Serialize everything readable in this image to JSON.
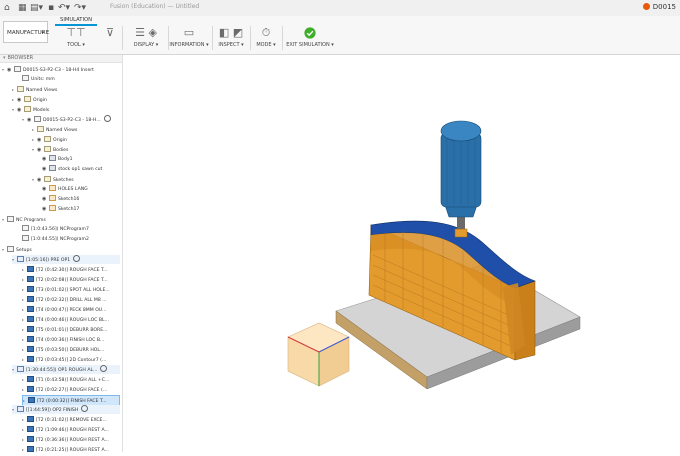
{
  "titlebar": {
    "doc_title": "Fusion (Education) — Untitled",
    "right_label": "D0015"
  },
  "toolbar": {
    "workspace": "MANUFACTURE",
    "active_tab": "SIMULATION",
    "groups": [
      {
        "label": "TOOL ▾"
      },
      {
        "label": "DISPLAY ▾"
      },
      {
        "label": "INFORMATION ▾"
      },
      {
        "label": "INSPECT ▾"
      },
      {
        "label": "MODE ▾"
      },
      {
        "label": "EXIT SIMULATION ▾"
      }
    ]
  },
  "browser": {
    "title": "BROWSER",
    "rows": [
      {
        "text": "D0015-S3-P2-C3 - 18-H4 Insert",
        "icon": "doc"
      },
      {
        "text": "Units: mm",
        "icon": "doc"
      },
      {
        "text": "Named Views",
        "icon": "folder"
      },
      {
        "text": "Origin",
        "icon": "folder"
      },
      {
        "text": "Models",
        "icon": "folder"
      },
      {
        "text": "D0015-S3-P2-C3 - 18-H...",
        "icon": "doc"
      },
      {
        "text": "Named Views",
        "icon": "folder"
      },
      {
        "text": "Origin",
        "icon": "folder"
      },
      {
        "text": "Bodies",
        "icon": "folder"
      },
      {
        "text": "Body1",
        "icon": "body"
      },
      {
        "text": "stock op1 sawn cut",
        "icon": "body"
      },
      {
        "text": "Sketches",
        "icon": "folder"
      },
      {
        "text": "HOLES LANG",
        "icon": "sketch"
      },
      {
        "text": "Sketch16",
        "icon": "sketch"
      },
      {
        "text": "Sketch17",
        "icon": "sketch"
      },
      {
        "text": "NC Programs",
        "icon": "doc"
      },
      {
        "text": "[1:0:43.56]) NCProgram7",
        "icon": "doc"
      },
      {
        "text": "[1:0:44.55]) NCProgram2",
        "icon": "doc"
      },
      {
        "text": "Setups",
        "icon": "doc"
      },
      {
        "text": "[1:05:16]) PRE OP1",
        "icon": "setup"
      },
      {
        "text": "[T2 (0:42:30)] ROUGH FACE T...",
        "icon": "op"
      },
      {
        "text": "[T2 (0:02:08)] ROUGH FACE T...",
        "icon": "op"
      },
      {
        "text": "[T3 (0:01:02)] SPOT ALL HOLE...",
        "icon": "op"
      },
      {
        "text": "[T2 (0:02:32)] DRILL ALL M8 ...",
        "icon": "op"
      },
      {
        "text": "[T4 (0:00:47)] PECK 8MM OU...",
        "icon": "op"
      },
      {
        "text": "[T4 (0:00:46)] ROUGH LOC BL...",
        "icon": "op"
      },
      {
        "text": "[T5 (0:01:01)] DEBURR BORE...",
        "icon": "op"
      },
      {
        "text": "[T4 (0:00:36)] FINISH LOC B...",
        "icon": "op"
      },
      {
        "text": "[T5 (0:03:50)] DEBURR HOL...",
        "icon": "op"
      },
      {
        "text": "[T2 (0:03:45)] 2D Contour7 (...",
        "icon": "op"
      },
      {
        "text": "[1:30:44:55]) OP1 ROUGH AL...",
        "icon": "setup"
      },
      {
        "text": "[T1 (0:43:58)] ROUGH ALL +C...",
        "icon": "op"
      },
      {
        "text": "[T2 (0:02:27)] ROUGH FACE (...",
        "icon": "op"
      },
      {
        "text": "[T2 (0:00:32)] FINISH FACE T...",
        "icon": "op"
      },
      {
        "text": "[[1:44:59]) OP2 FINISH",
        "icon": "setup"
      },
      {
        "text": "[T2 (0:31:02)] REMOVE EXCE...",
        "icon": "op"
      },
      {
        "text": "[T2 (1:09:46)] ROUGH REST A...",
        "icon": "op"
      },
      {
        "text": "[T2 (0:36:36)] ROUGH REST A...",
        "icon": "op"
      },
      {
        "text": "[T2 (0:21:25)] ROUGH REST A...",
        "icon": "op"
      },
      {
        "text": "[T2 (0:04:15)] REMOVE FACE...",
        "icon": "op"
      }
    ]
  },
  "colors": {
    "accent": "#0696d7",
    "part_orange": "#e39b2e",
    "part_blue": "#1f4fa8",
    "tool_blue": "#2a6fa8",
    "fixture_grey": "#c9c9c9",
    "exit_green": "#3fae2a"
  },
  "icons": {
    "exit_simulation": "check-circle-icon",
    "viewcube": "viewcube-icon"
  }
}
